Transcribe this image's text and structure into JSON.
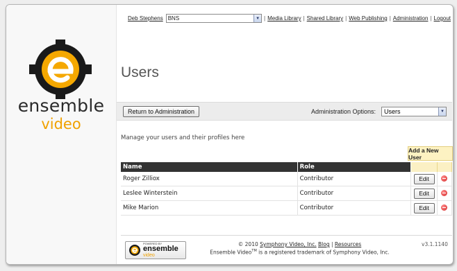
{
  "topnav": {
    "user_name": "Deb Stephens",
    "org_select": "BNS",
    "separator": "|",
    "links": [
      "Media Library",
      "Shared Library",
      "Web Publishing",
      "Administration",
      "Logout"
    ]
  },
  "brand": {
    "line1": "ensemble",
    "line2": "video"
  },
  "page": {
    "title": "Users",
    "description": "Manage your users and their profiles here"
  },
  "admin_bar": {
    "return_label": "Return to Administration",
    "options_label": "Administration Options:",
    "options_selected": "Users"
  },
  "add_user_label": "Add a New User",
  "table": {
    "headers": [
      "Name",
      "Role"
    ],
    "edit_label": "Edit",
    "rows": [
      {
        "name": "Roger Zilliox",
        "role": "Contributor"
      },
      {
        "name": "Leslee Winterstein",
        "role": "Contributor"
      },
      {
        "name": "Mike Marion",
        "role": "Contributor"
      }
    ]
  },
  "footer": {
    "powered_by": "POWERED BY",
    "badge_brand": "ensemble",
    "badge_sub": "video",
    "copyright": "© 2010",
    "company_link": "Symphony Video, Inc.",
    "blog_link": "Blog",
    "divider": "|",
    "resources_link": "Resources",
    "trademark_pre": "Ensemble Video",
    "trademark_sup": "TM",
    "trademark_post": "is a registered trademark of Symphony Video, Inc.",
    "version": "v3.1.1140"
  },
  "colors": {
    "brand_orange": "#f0a100",
    "header_dark": "#333333",
    "add_user_bg": "#fdf2c2"
  }
}
